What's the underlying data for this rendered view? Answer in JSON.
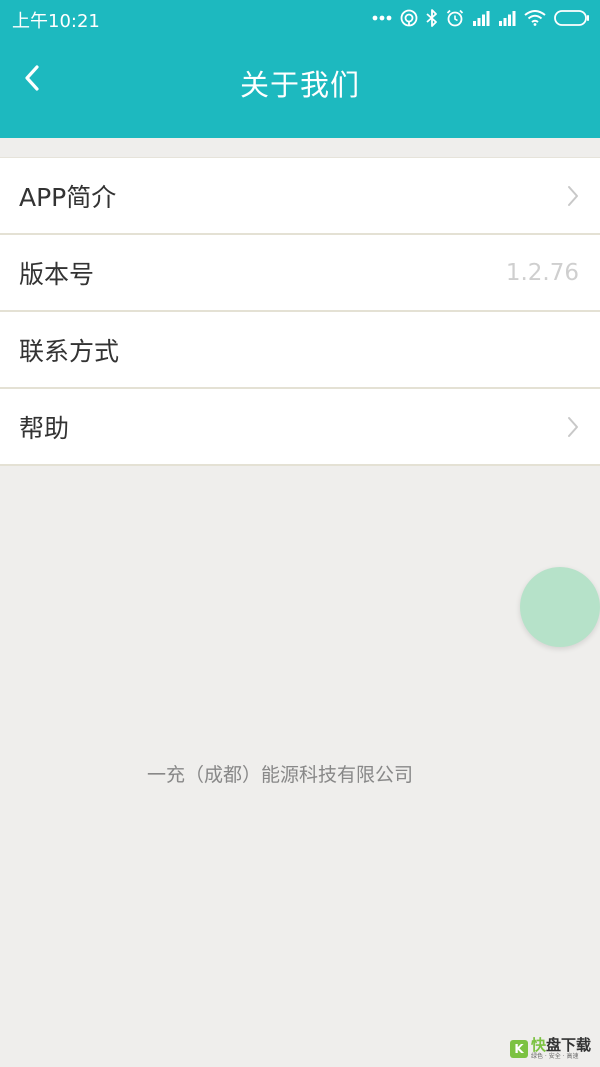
{
  "status_bar": {
    "time": "上午10:21",
    "icons": [
      "more-dots-icon",
      "hotspot-icon",
      "bluetooth-icon",
      "alarm-icon",
      "signal-icon",
      "signal-icon",
      "wifi-icon",
      "battery-icon"
    ]
  },
  "header": {
    "title": "关于我们",
    "back_icon": "chevron-left-icon",
    "background": "#1db9bf"
  },
  "menu": {
    "items": [
      {
        "label": "APP简介",
        "value": "",
        "chevron": true
      },
      {
        "label": "版本号",
        "value": "1.2.76",
        "chevron": false
      },
      {
        "label": "联系方式",
        "value": "",
        "chevron": false
      },
      {
        "label": "帮助",
        "value": "",
        "chevron": true
      }
    ]
  },
  "footer": {
    "company": "一充（成都）能源科技有限公司"
  },
  "watermark": {
    "mark": "K",
    "name_a": "快",
    "name_b": "盘下载",
    "tagline": "绿色 · 安全 · 高速"
  },
  "colors": {
    "accent": "#1db9bf",
    "fab": "#b6e2c9",
    "background": "#efeeec"
  }
}
